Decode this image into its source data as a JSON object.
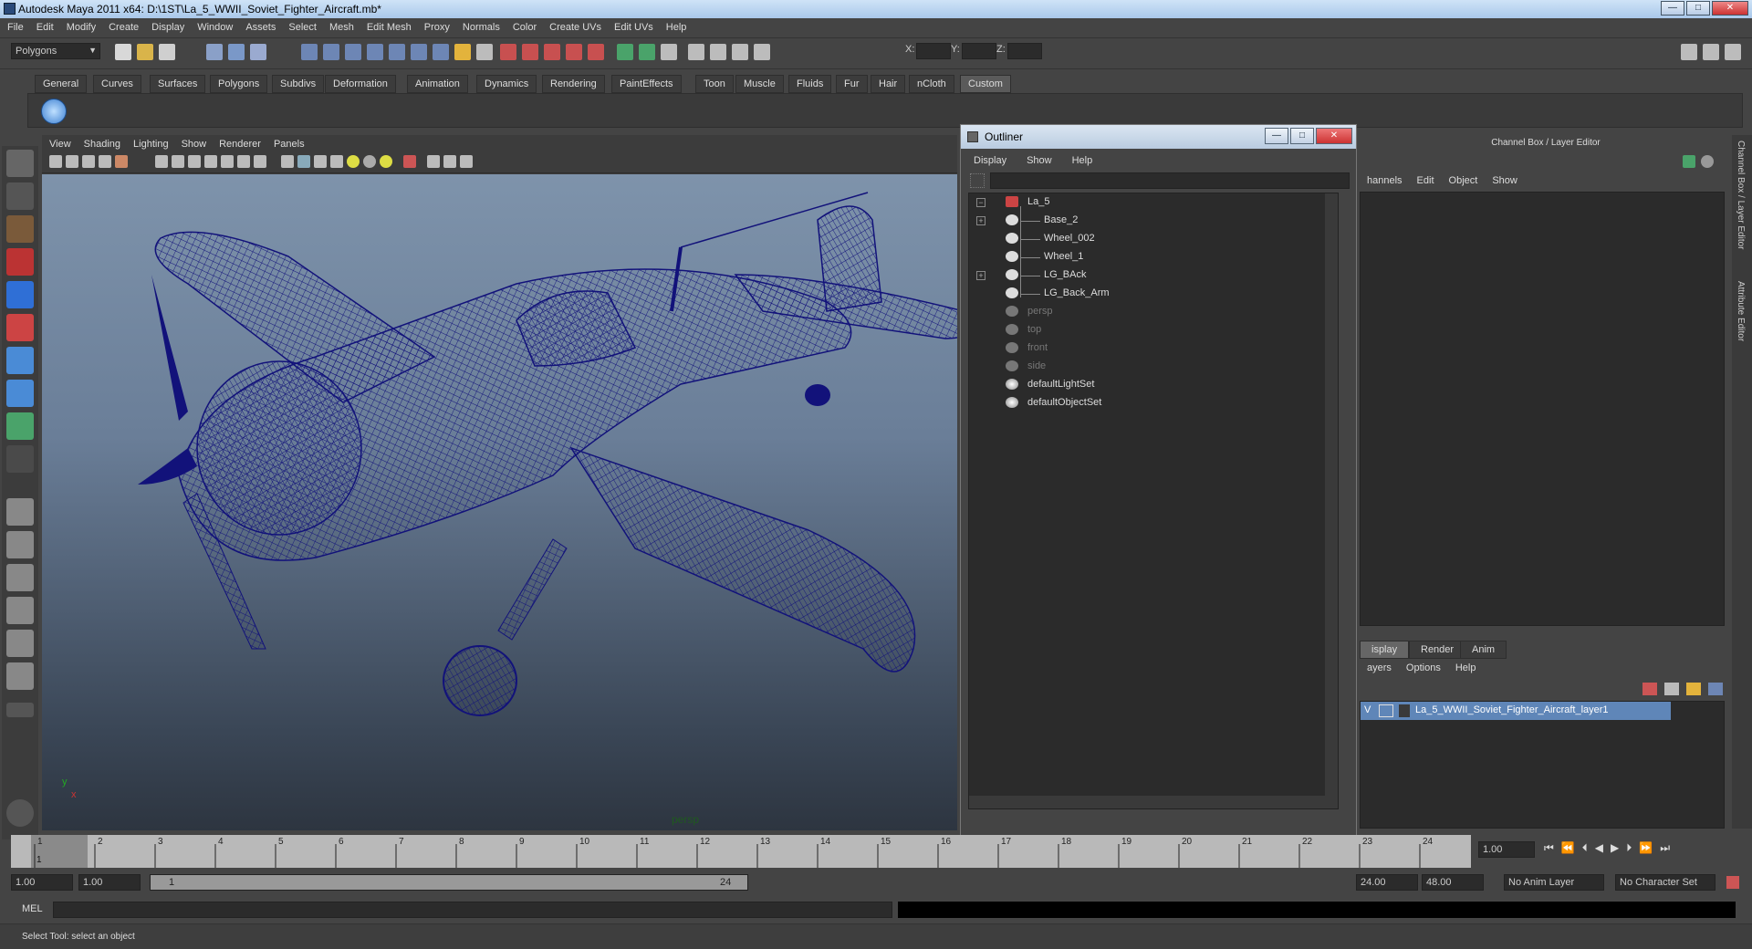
{
  "window": {
    "title": "Autodesk Maya 2011 x64: D:\\1ST\\La_5_WWII_Soviet_Fighter_Aircraft.mb*",
    "min": "—",
    "max": "□",
    "close": "✕"
  },
  "menubar": [
    "File",
    "Edit",
    "Modify",
    "Create",
    "Display",
    "Window",
    "Assets",
    "Select",
    "Mesh",
    "Edit Mesh",
    "Proxy",
    "Normals",
    "Color",
    "Create UVs",
    "Edit UVs",
    "Help"
  ],
  "status": {
    "mode": "Polygons",
    "x_label": "X:",
    "y_label": "Y:",
    "z_label": "Z:"
  },
  "shelf_tabs": [
    "General",
    "Curves",
    "Surfaces",
    "Polygons",
    "Subdivs",
    "Deformation",
    "Animation",
    "Dynamics",
    "Rendering",
    "PaintEffects",
    "Toon",
    "Muscle",
    "Fluids",
    "Fur",
    "Hair",
    "nCloth",
    "Custom"
  ],
  "shelf_active": "Custom",
  "viewport": {
    "menu": [
      "View",
      "Shading",
      "Lighting",
      "Show",
      "Renderer",
      "Panels"
    ],
    "camera_label": "persp",
    "axis_y": "y",
    "axis_x": "x"
  },
  "outliner": {
    "title": "Outliner",
    "menu": [
      "Display",
      "Show",
      "Help"
    ],
    "items": [
      {
        "label": "La_5",
        "dim": false
      },
      {
        "label": "Base_2",
        "dim": false
      },
      {
        "label": "Wheel_002",
        "dim": false
      },
      {
        "label": "Wheel_1",
        "dim": false
      },
      {
        "label": "LG_BAck",
        "dim": false
      },
      {
        "label": "LG_Back_Arm",
        "dim": false
      },
      {
        "label": "persp",
        "dim": true
      },
      {
        "label": "top",
        "dim": true
      },
      {
        "label": "front",
        "dim": true
      },
      {
        "label": "side",
        "dim": true
      },
      {
        "label": "defaultLightSet",
        "dim": false
      },
      {
        "label": "defaultObjectSet",
        "dim": false
      }
    ]
  },
  "channelbox": {
    "title": "Channel Box / Layer Editor",
    "menu": [
      "hannels",
      "Edit",
      "Object",
      "Show"
    ],
    "layer_tabs": [
      "isplay",
      "Render",
      "Anim"
    ],
    "layer_menu": [
      "ayers",
      "Options",
      "Help"
    ],
    "layer_name": "La_5_WWII_Soviet_Fighter_Aircraft_layer1",
    "layer_v": "V",
    "side_tab_1": "Channel Box / Layer Editor",
    "side_tab_2": "Attribute Editor"
  },
  "timeline": {
    "ticks": [
      "1",
      "2",
      "3",
      "4",
      "5",
      "6",
      "7",
      "8",
      "9",
      "10",
      "11",
      "12",
      "13",
      "14",
      "15",
      "16",
      "17",
      "18",
      "19",
      "20",
      "21",
      "22",
      "23",
      "24"
    ],
    "current": "1",
    "current_field": "1.00"
  },
  "range": {
    "start": "1.00",
    "start2": "1.00",
    "inner_start": "1",
    "inner_end": "24",
    "end": "24.00",
    "end2": "48.00",
    "anim_layer": "No Anim Layer",
    "char_set": "No Character Set"
  },
  "cmd": {
    "label": "MEL"
  },
  "help": {
    "text": "Select Tool: select an object"
  },
  "colors": {
    "wire": "#12127a",
    "accent": "#5f86b8"
  }
}
